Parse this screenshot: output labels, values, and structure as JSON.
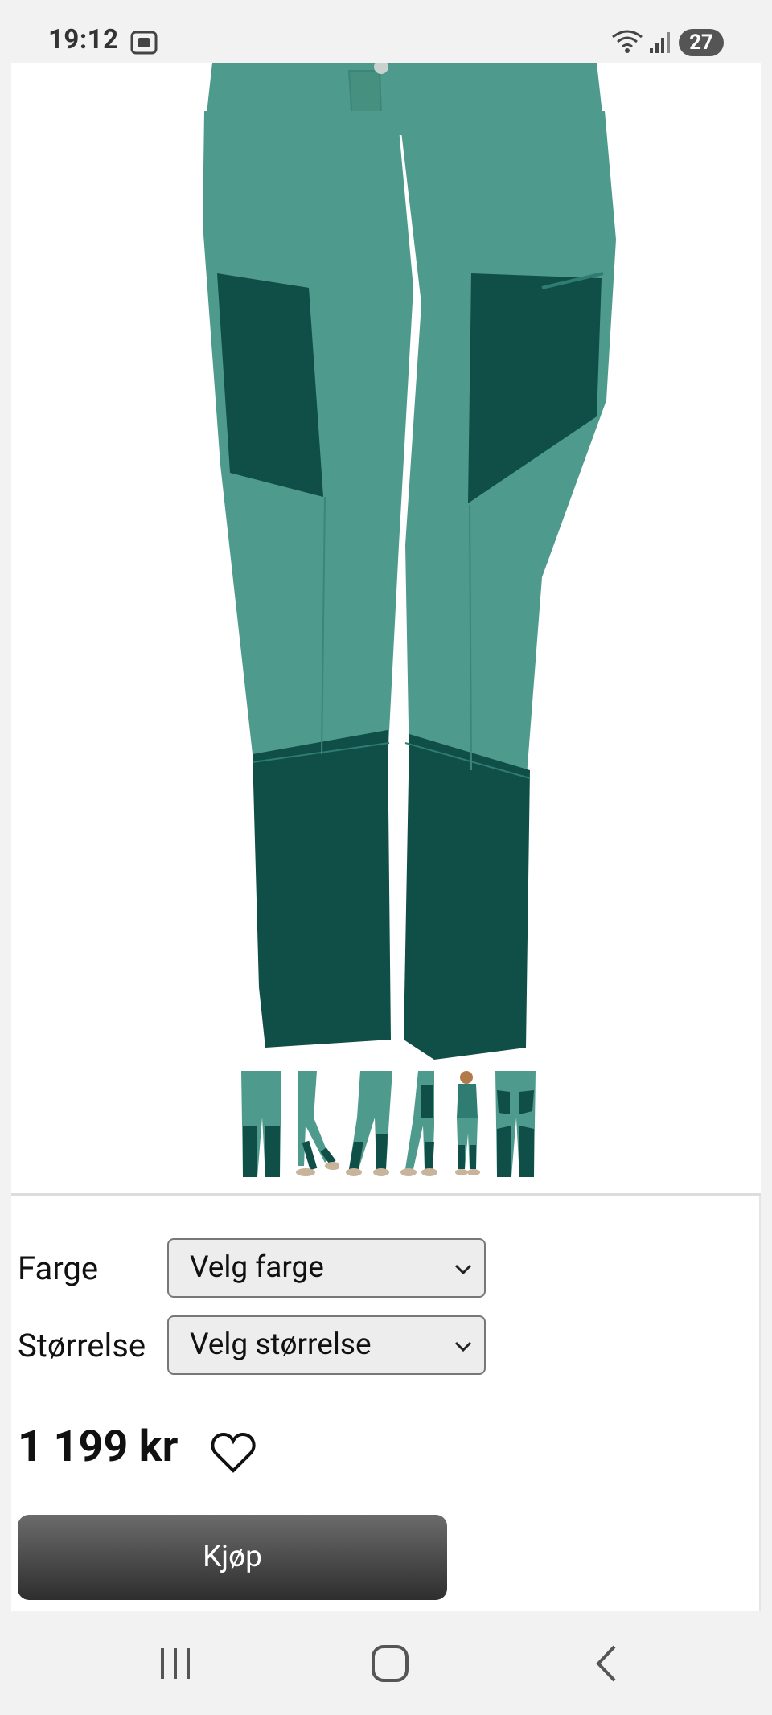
{
  "status_bar": {
    "time": "19:12",
    "battery": "27",
    "icons": [
      "screenshot-icon",
      "wifi-icon",
      "signal-icon"
    ]
  },
  "product": {
    "colors": {
      "pants_light": "#4e9a8c",
      "pants_dark": "#0f4f48",
      "accent": "#2f7d72"
    },
    "thumbnails": [
      "thumbnail-1",
      "thumbnail-2",
      "thumbnail-3",
      "thumbnail-4",
      "thumbnail-5",
      "thumbnail-6"
    ]
  },
  "options": {
    "color_label": "Farge",
    "color_select": "Velg farge",
    "size_label": "Størrelse",
    "size_select": "Velg størrelse"
  },
  "price": "1 199 kr",
  "buy_label": "Kjøp",
  "nav": [
    "recents",
    "home",
    "back"
  ]
}
